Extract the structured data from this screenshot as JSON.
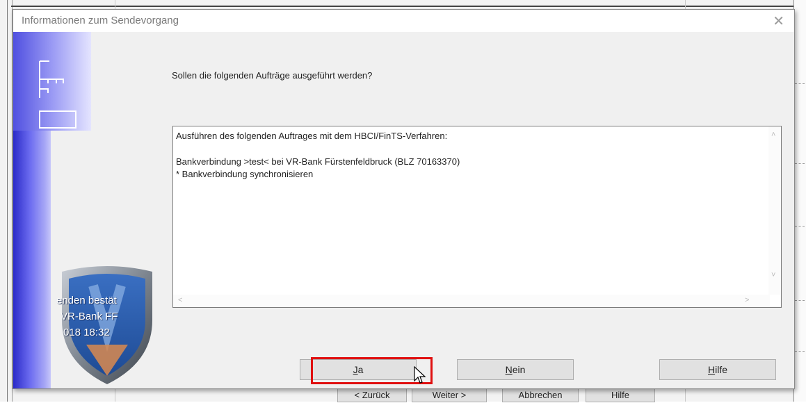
{
  "dialog": {
    "title": "Informationen zum Sendevorgang",
    "close_glyph": "✕",
    "question": "Sollen die folgenden Aufträge ausgeführt werden?",
    "details": [
      "Ausführen des folgenden Auftrages mit dem HBCI/FinTS-Verfahren:",
      "",
      "Bankverbindung >test< bei VR-Bank Fürstenfeldbruck (BLZ 70163370)",
      "* Bankverbindung synchronisieren"
    ],
    "scroll_arrows": {
      "up": "˄",
      "down": "˅",
      "left": "<",
      "right": ">"
    },
    "buttons": {
      "yes_accel": "J",
      "yes_rest": "a",
      "no_accel": "N",
      "no_rest": "ein",
      "help_accel": "H",
      "help_rest": "ilfe"
    }
  },
  "shield_badge": {
    "line1": "enden bestät",
    "line2": "VR-Bank FF",
    "line3": "018  18:32"
  },
  "background_buttons": {
    "back": "< Zurück",
    "next": "Weiter >",
    "cancel": "Abbrechen",
    "help": "Hilfe"
  },
  "colors": {
    "highlight": "#e01010",
    "side_panel_dark": "#2a2ac8",
    "side_panel_light": "#c6c6fa"
  },
  "icons": [
    "close-icon",
    "form-icon",
    "shield-logo",
    "mouse-cursor-icon"
  ]
}
